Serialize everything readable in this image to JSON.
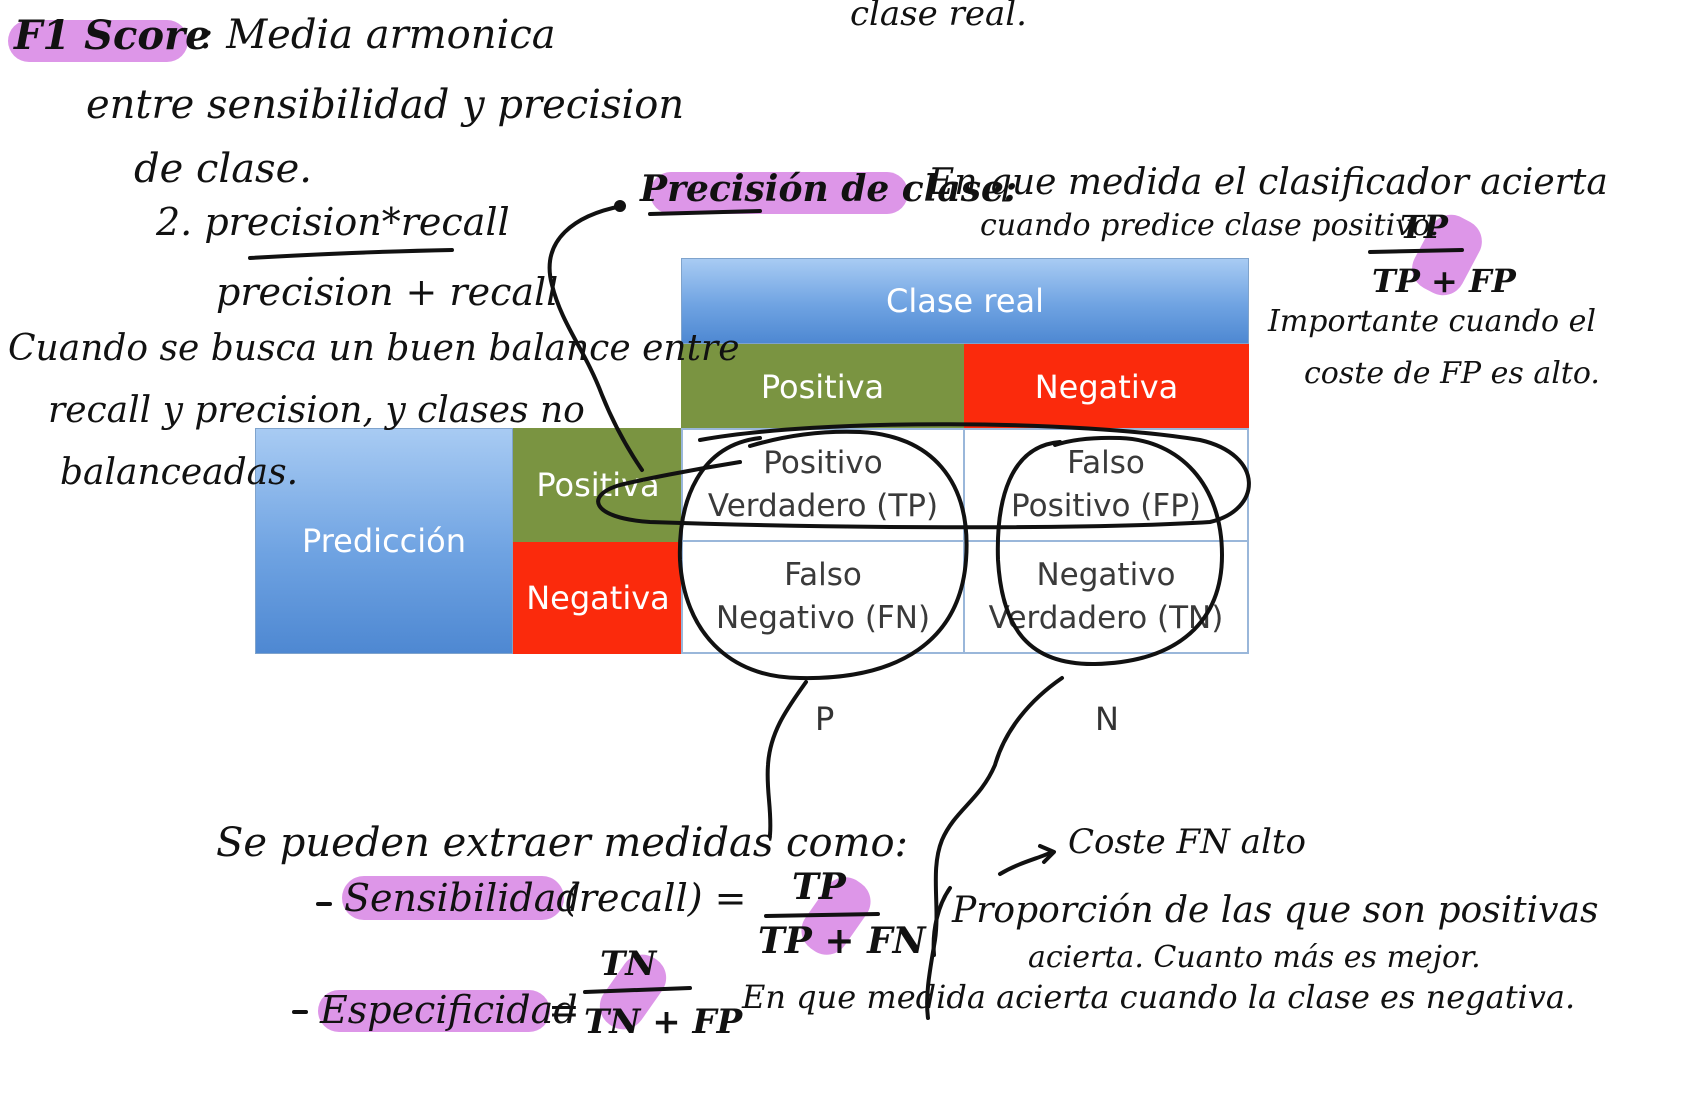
{
  "matrix": {
    "clase_real": "Clase real",
    "prediccion": "Predicción",
    "col_pos": "Positiva",
    "col_neg": "Negativa",
    "row_pos": "Positiva",
    "row_neg": "Negativa",
    "tp_line1": "Positivo",
    "tp_line2": "Verdadero (TP)",
    "fp_line1": "Falso",
    "fp_line2": "Positivo (FP)",
    "fn_line1": "Falso",
    "fn_line2": "Negativo (FN)",
    "tn_line1": "Negativo",
    "tn_line2": "Verdadero (TN)",
    "p_label": "P",
    "n_label": "N"
  },
  "notes": {
    "top_fragment": "clase real.",
    "f1_title": "F1 Score",
    "f1_desc_1": ": Media armonica",
    "f1_desc_2": "entre sensibilidad y precision",
    "f1_desc_3": "de clase.",
    "f1_formula_num": "2. precision*recall",
    "f1_formula_den": "precision + recall",
    "balance_1": "Cuando se busca un buen balance entre",
    "balance_2": "recall y precision, y clases no",
    "balance_3": "balanceadas.",
    "precision_title": "Precisión de clase:",
    "precision_desc_1": "En que medida el clasificador acierta",
    "precision_desc_2": "cuando predice clase positivo.",
    "precision_num": "TP",
    "precision_den": "TP + FP",
    "important_1": "Importante cuando el",
    "important_2": "coste de FP es alto.",
    "measures_intro": "Se pueden extraer medidas como:",
    "sens_label": "Sensibilidad",
    "sens_suffix": "(recall) =",
    "sens_num": "TP",
    "sens_den": "TP + FN",
    "cost_fn": "Coste FN alto",
    "prop_1": "Proporción de las que son positivas",
    "prop_2": "acierta. Cuanto más es mejor.",
    "spec_label": "Especificidad",
    "spec_suffix": "=",
    "spec_num": "TN",
    "spec_den": "TN + FP",
    "spec_desc": "En que medida acierta cuando la clase es negativa."
  },
  "colors": {
    "highlight": "#d98be6",
    "blue": "#5b93d8",
    "green": "#7a9441",
    "red": "#fb2a0c",
    "ink": "#111111"
  }
}
